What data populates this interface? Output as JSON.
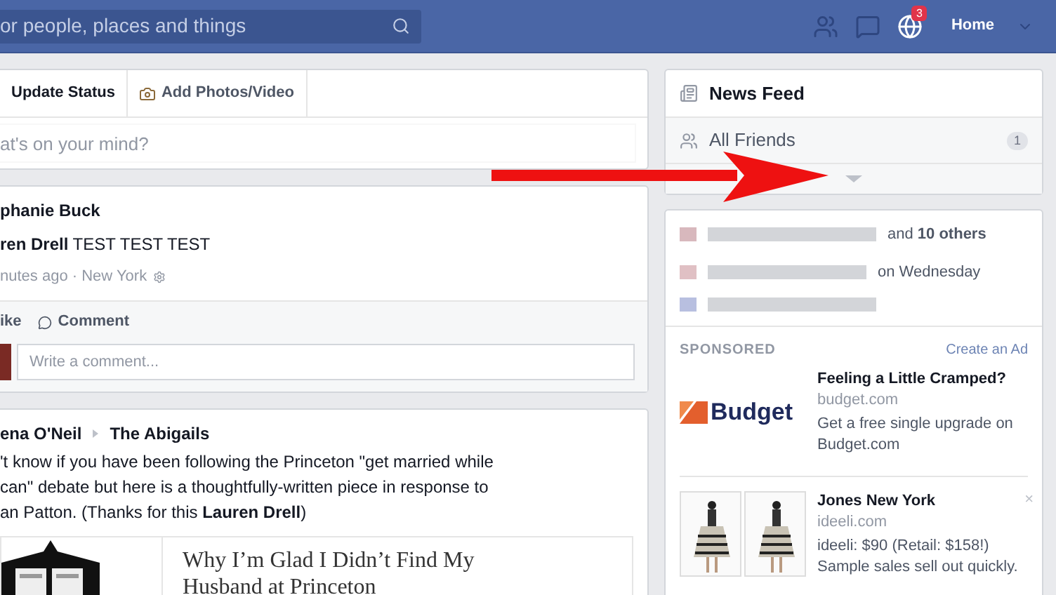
{
  "top_bar": {
    "search": {
      "placeholder": "or people, places and things"
    },
    "notification_count": "3",
    "home": "Home"
  },
  "composer": {
    "tabs": [
      {
        "label": "Update Status",
        "selected": true
      },
      {
        "label": "Add Photos/Video",
        "selected": false
      }
    ],
    "placeholder": "at's on your mind?"
  },
  "post": {
    "author": "phanie Buck",
    "text": "**ren Drell** TEST TEST TEST",
    "meta": "nutes ago · New York",
    "actions": [
      "ike",
      "Comment"
    ],
    "comment_placeholder": "Write a comment..."
  },
  "post2": {
    "author": "ena O'Neil",
    "target": "The Abigails",
    "text": [
      "'t know if you have been following the Princeton \"get married while",
      " can\" debate but here is a thoughtfully-written piece in response to",
      "an Patton. (Thanks for this **Lauren Drell**)"
    ],
    "link_title": "Why I’m Glad I Didn’t Find My Husband at Princeton"
  },
  "sidebar": {
    "items": [
      {
        "label": "News Feed",
        "kind": "feed"
      },
      {
        "label": "All Friends",
        "kind": "friends",
        "count": "1"
      }
    ]
  },
  "activity": [
    {
      "text": "and **10 others**",
      "color": "#d8b8bd"
    },
    {
      "text": "on Wednesday",
      "color": "#e0c0c4"
    },
    {
      "color": "#b8bfe0"
    }
  ],
  "sponsored": {
    "label": "SPONSORED",
    "create": "Create an Ad",
    "ads": [
      {
        "kind": "logo",
        "title": "Feeling a Little Cramped?",
        "domain": "budget.com",
        "logo": "Budget",
        "body": [
          "Get a free single upgrade on",
          "Budget.com"
        ]
      },
      {
        "kind": "photos",
        "title": "Jones New York",
        "domain": "ideeli.com",
        "body": [
          "ideeli: $90 (Retail: $158!)",
          "Sample sales sell out quickly."
        ],
        "close": "×"
      }
    ]
  }
}
